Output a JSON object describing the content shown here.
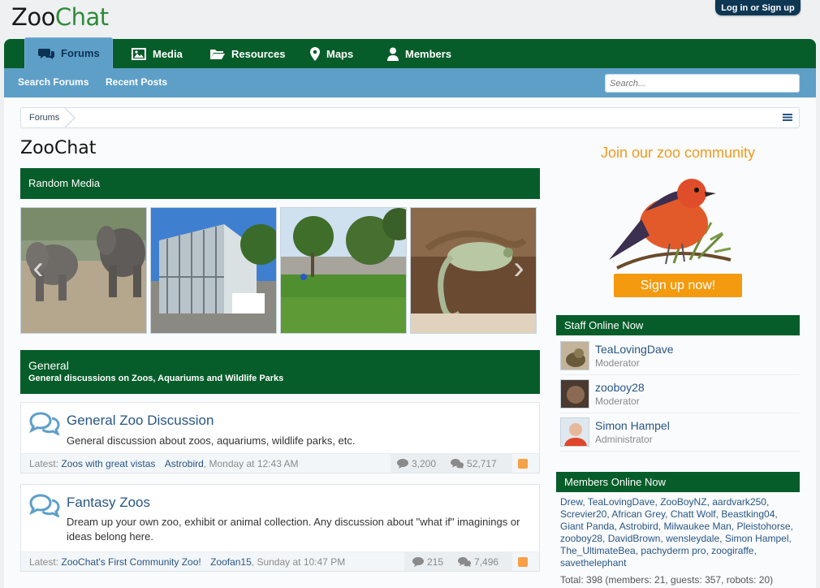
{
  "header": {
    "logo_text_a": "Zoo",
    "logo_text_b": "Chat",
    "login_label": "Log in or Sign up"
  },
  "nav": {
    "tabs": [
      {
        "label": "Forums",
        "icon": "comments-icon",
        "active": true
      },
      {
        "label": "Media",
        "icon": "image-icon"
      },
      {
        "label": "Resources",
        "icon": "folder-icon"
      },
      {
        "label": "Maps",
        "icon": "map-marker-icon"
      },
      {
        "label": "Members",
        "icon": "user-icon"
      }
    ],
    "sub_links": [
      "Search Forums",
      "Recent Posts"
    ],
    "search_placeholder": "Search..."
  },
  "breadcrumb": [
    "Forums"
  ],
  "page_title": "ZooChat",
  "random_media": {
    "heading": "Random Media",
    "thumbs": [
      "elephants",
      "greenhouse",
      "zoo-enclosure",
      "chameleon"
    ]
  },
  "general": {
    "heading": "General",
    "subheading": "General discussions on Zoos, Aquariums and Wildlife Parks",
    "forums": [
      {
        "title": "General Zoo Discussion",
        "description": "General discussion about zoos, aquariums, wildlife parks, etc.",
        "latest_prefix": "Latest:",
        "latest_thread": "Zoos with great vistas",
        "latest_user": "Astrobird",
        "latest_time": "Monday at 12:43 AM",
        "threads": "3,200",
        "messages": "52,717"
      },
      {
        "title": "Fantasy Zoos",
        "description": "Dream up your own zoo, exhibit or animal collection. Any discussion about \"what if\" imaginings or ideas belong here.",
        "latest_prefix": "Latest:",
        "latest_thread": "ZooChat's First Community Zoo!",
        "latest_user": "Zoofan15",
        "latest_time": "Sunday at 10:47 PM",
        "threads": "215",
        "messages": "7,496"
      }
    ]
  },
  "sidebar": {
    "join_text": "Join our zoo community",
    "signup_label": "Sign up now!",
    "staff_heading": "Staff Online Now",
    "staff": [
      {
        "name": "TeaLovingDave",
        "role": "Moderator"
      },
      {
        "name": "zooboy28",
        "role": "Moderator"
      },
      {
        "name": "Simon Hampel",
        "role": "Administrator"
      }
    ],
    "members_heading": "Members Online Now",
    "members": [
      "Drew",
      "TeaLovingDave",
      "ZooBoyNZ",
      "aardvark250",
      "Screvier20",
      "African Grey",
      "Chatt Wolf",
      "Beastking04",
      "Giant Panda",
      "Astrobird",
      "Milwaukee Man",
      "Pleistohorse",
      "zooboy28",
      "DavidBrown",
      "wensleydale",
      "Simon Hampel",
      "The_UltimateBea",
      "pachyderm pro",
      "zoogiraffe",
      "savethelephant"
    ],
    "members_total": "Total: 398 (members: 21, guests: 357, robots: 20)"
  },
  "colors": {
    "brand_green": "#075d2a",
    "accent_blue": "#5e9fc8",
    "link_blue": "#285683",
    "signup_orange": "#f39a0e"
  }
}
